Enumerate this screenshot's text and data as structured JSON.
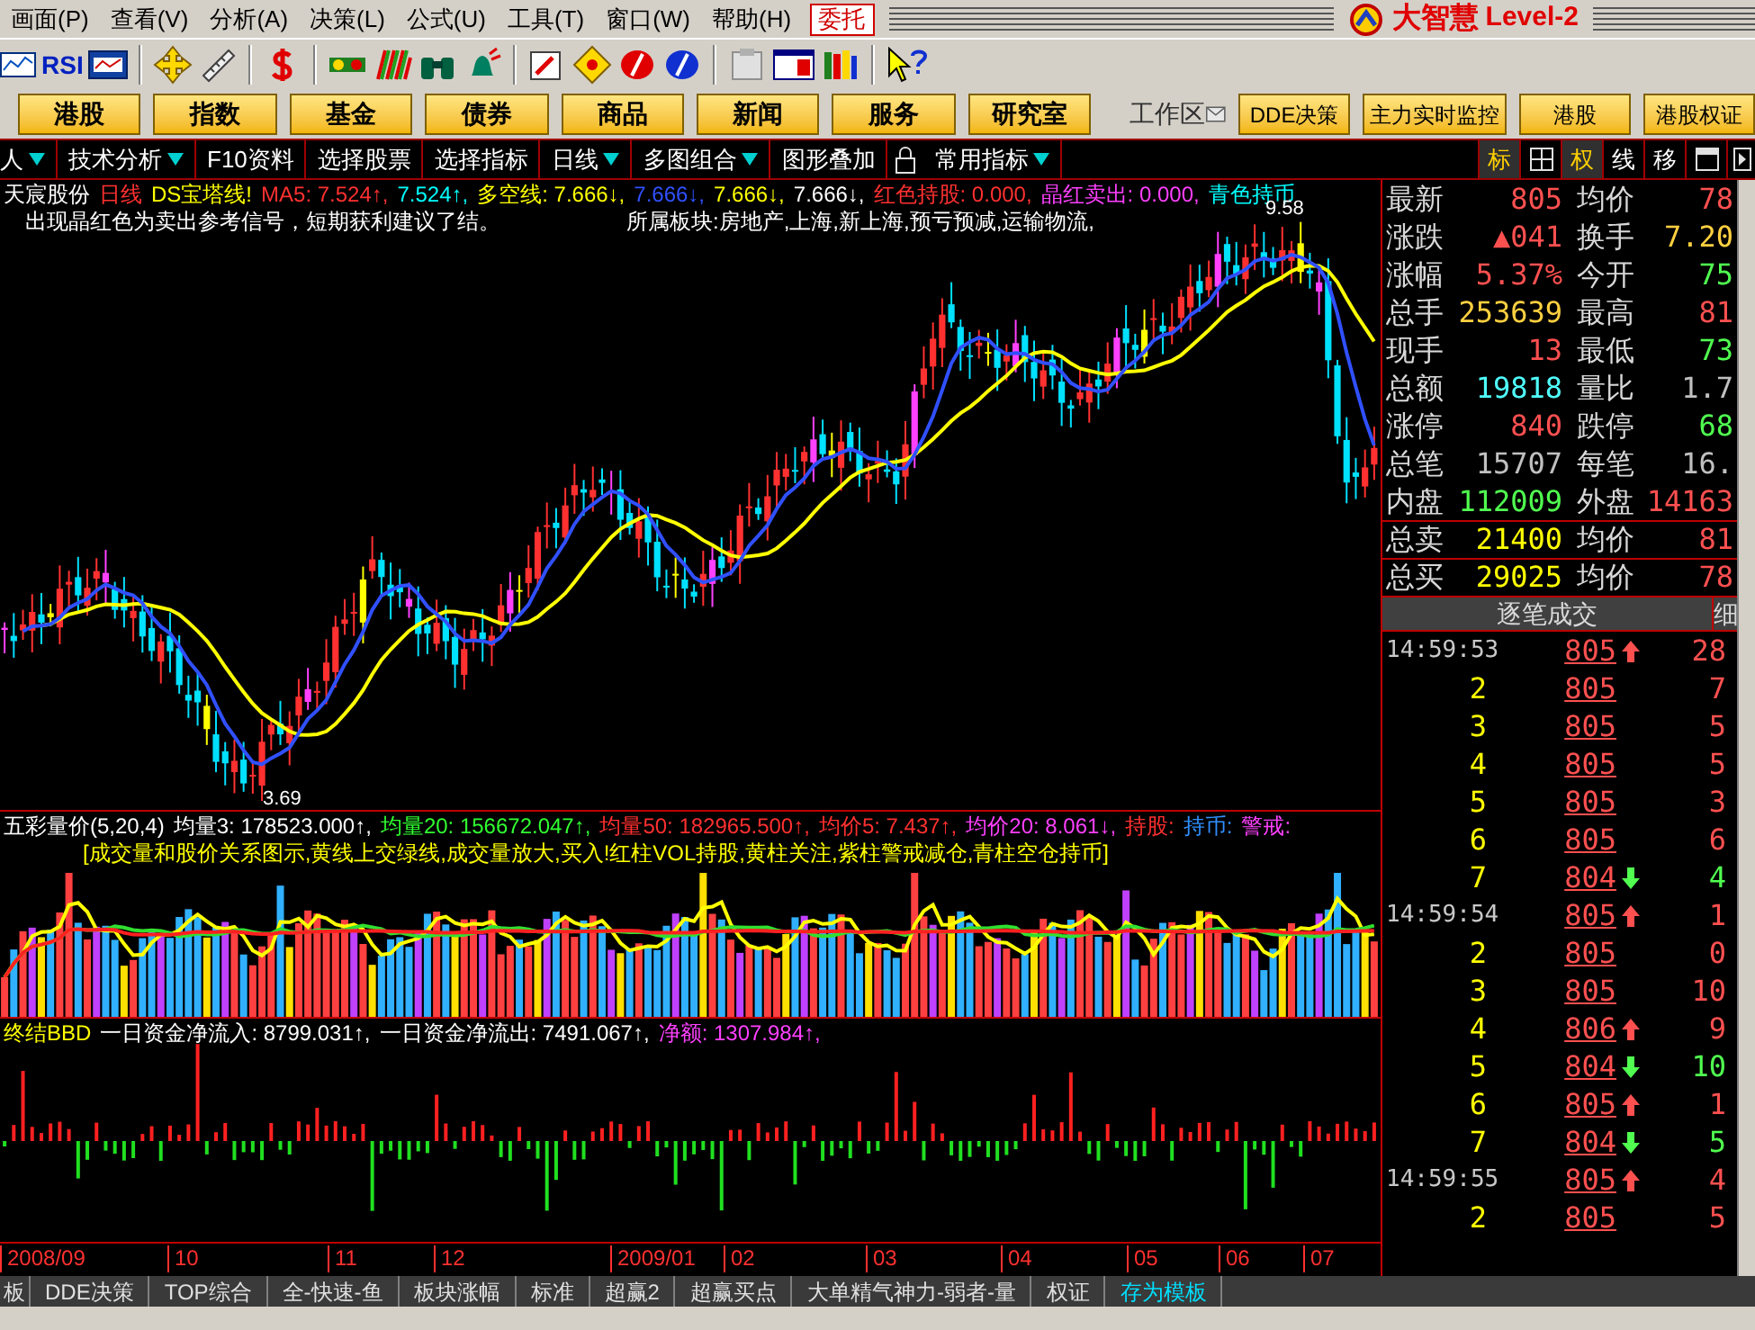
{
  "menu": [
    {
      "label": "画面(P)"
    },
    {
      "label": "查看(V)"
    },
    {
      "label": "分析(A)"
    },
    {
      "label": "决策(L)"
    },
    {
      "label": "公式(U)"
    },
    {
      "label": "工具(T)"
    },
    {
      "label": "窗口(W)"
    },
    {
      "label": "帮助(H)"
    }
  ],
  "entrust_button": "委托",
  "brand": {
    "name": "大智慧",
    "edition": "Level-2"
  },
  "toolbar": {
    "rsi_label": "RSI"
  },
  "nav_buttons": [
    "港股",
    "指数",
    "基金",
    "债券",
    "商品",
    "新闻",
    "服务",
    "研究室"
  ],
  "workspace_label": "工作区",
  "right_buttons": [
    "DDE决策",
    "主力实时监控",
    "港股",
    "港股权证"
  ],
  "tabs": [
    {
      "label": "人",
      "dropdown": true
    },
    {
      "label": "技术分析",
      "dropdown": true
    },
    {
      "label": "F10资料",
      "dropdown": false
    },
    {
      "label": "选择股票",
      "dropdown": false
    },
    {
      "label": "选择指标",
      "dropdown": false
    },
    {
      "label": "日线",
      "dropdown": true
    },
    {
      "label": "多图组合",
      "dropdown": true
    },
    {
      "label": "图形叠加",
      "dropdown": false
    },
    {
      "label": "常用指标",
      "dropdown": true
    }
  ],
  "view_toggles": [
    {
      "kind": "text",
      "label": "标",
      "selected": true
    },
    {
      "kind": "grid"
    },
    {
      "kind": "text",
      "label": "权",
      "selected": true
    },
    {
      "kind": "text",
      "label": "线",
      "selected": false
    },
    {
      "kind": "text",
      "label": "移",
      "selected": false
    },
    {
      "kind": "window"
    },
    {
      "kind": "play"
    }
  ],
  "price_chart": {
    "legend": [
      {
        "text": "天宸股份",
        "color": "#ffffff"
      },
      {
        "text": "日线",
        "color": "#ff3030"
      },
      {
        "text": "DS宝塔线!",
        "color": "#ffff00"
      },
      {
        "text": "MA5: 7.524↑,",
        "color": "#ff3030"
      },
      {
        "text": "7.524↑,",
        "color": "#00ffff"
      },
      {
        "text": "多空线: 7.666↓,",
        "color": "#ffff00"
      },
      {
        "text": "7.666↓,",
        "color": "#3050ff"
      },
      {
        "text": "7.666↓,",
        "color": "#ffff00"
      },
      {
        "text": "7.666↓,",
        "color": "#ffffff"
      },
      {
        "text": "红色持股: 0.000,",
        "color": "#ff3030"
      },
      {
        "text": "晶红卖出: 0.000,",
        "color": "#ff40ff"
      },
      {
        "text": "青色持币",
        "color": "#00ffff"
      }
    ],
    "notes": [
      "出现晶红色为卖出参考信号，短期获利建议了结。",
      "所属板块:房地产,上海,新上海,预亏预减,运输物流,"
    ],
    "high_label": "9.58",
    "low_label": "3.69"
  },
  "volume_chart": {
    "legend": [
      {
        "text": "五彩量价(5,20,4)",
        "color": "#ffffff"
      },
      {
        "text": "均量3: 178523.000↑,",
        "color": "#ffffff"
      },
      {
        "text": "均量20: 156672.047↑,",
        "color": "#30ff30"
      },
      {
        "text": "均量50: 182965.500↑,",
        "color": "#ff3030"
      },
      {
        "text": "均价5: 7.437↑,",
        "color": "#ff3030"
      },
      {
        "text": "均价20: 8.061↓,",
        "color": "#ff40ff"
      },
      {
        "text": "持股:",
        "color": "#ff3030"
      },
      {
        "text": "持币:",
        "color": "#3090ff"
      },
      {
        "text": "警戒:",
        "color": "#ff40ff"
      }
    ],
    "note": "[成交量和股价关系图示,黄线上交绿线,成交量放大,买入!红柱VOL持股,黄柱关注,紫柱警戒减仓,青柱空仓持币]"
  },
  "bbd_chart": {
    "legend": [
      {
        "text": "终结BBD",
        "color": "#ffff00"
      },
      {
        "text": "一日资金净流入: 8799.031↑,",
        "color": "#ffffff"
      },
      {
        "text": "一日资金净流出: 7491.067↑,",
        "color": "#ffffff"
      },
      {
        "text": "净额: 1307.984↑,",
        "color": "#ff40ff"
      }
    ]
  },
  "time_axis": [
    "2008/09",
    "10",
    "11",
    "12",
    "2009/01",
    "02",
    "03",
    "04",
    "05",
    "06",
    "07"
  ],
  "quote": [
    {
      "left": {
        "label": "最新",
        "value": "805",
        "color": "#ff5050"
      },
      "right": {
        "label": "均价",
        "value": "78",
        "color": "#ff5050"
      }
    },
    {
      "left": {
        "label": "涨跌",
        "value": "▲041",
        "color": "#ff5050"
      },
      "right": {
        "label": "换手",
        "value": "7.20",
        "color": "#ffd040"
      }
    },
    {
      "left": {
        "label": "涨幅",
        "value": "5.37%",
        "color": "#ff5050"
      },
      "right": {
        "label": "今开",
        "value": "75",
        "color": "#50ff50"
      }
    },
    {
      "left": {
        "label": "总手",
        "value": "253639",
        "color": "#ffd040"
      },
      "right": {
        "label": "最高",
        "value": "81",
        "color": "#ff5050"
      }
    },
    {
      "left": {
        "label": "现手",
        "value": "13",
        "color": "#ff5050"
      },
      "right": {
        "label": "最低",
        "value": "73",
        "color": "#50ff50"
      }
    },
    {
      "left": {
        "label": "总额",
        "value": "19818",
        "color": "#50ffff"
      },
      "right": {
        "label": "量比",
        "value": "1.7",
        "color": "#c0c0c0"
      }
    },
    {
      "left": {
        "label": "涨停",
        "value": "840",
        "color": "#ff5050"
      },
      "right": {
        "label": "跌停",
        "value": "68",
        "color": "#50ff50"
      }
    },
    {
      "left": {
        "label": "总笔",
        "value": "15707",
        "color": "#c0c0c0"
      },
      "right": {
        "label": "每笔",
        "value": "16.",
        "color": "#c0c0c0"
      }
    },
    {
      "left": {
        "label": "内盘",
        "value": "112009",
        "color": "#50ff50"
      },
      "right": {
        "label": "外盘",
        "value": "14163",
        "color": "#ff5050"
      }
    }
  ],
  "order_totals": [
    {
      "label": "总卖",
      "value": "21400",
      "label2": "均价",
      "value2": "81"
    },
    {
      "label": "总买",
      "value": "29025",
      "label2": "均价",
      "value2": "78"
    }
  ],
  "trades_header": "逐笔成交",
  "trades_side_tab": "细",
  "trades": [
    {
      "kind": "time",
      "time": "14:59:53",
      "price": "805",
      "rising": true,
      "falling": false,
      "volume": "28",
      "color": "#ff5050"
    },
    {
      "kind": "seq",
      "time": "2",
      "price": "805",
      "rising": false,
      "falling": false,
      "volume": "7",
      "color": "#ff5050"
    },
    {
      "kind": "seq",
      "time": "3",
      "price": "805",
      "rising": false,
      "falling": false,
      "volume": "5",
      "color": "#ff5050"
    },
    {
      "kind": "seq",
      "time": "4",
      "price": "805",
      "rising": false,
      "falling": false,
      "volume": "5",
      "color": "#ff5050"
    },
    {
      "kind": "seq",
      "time": "5",
      "price": "805",
      "rising": false,
      "falling": false,
      "volume": "3",
      "color": "#ff5050"
    },
    {
      "kind": "seq",
      "time": "6",
      "price": "805",
      "rising": false,
      "falling": false,
      "volume": "6",
      "color": "#ff5050"
    },
    {
      "kind": "seq",
      "time": "7",
      "price": "804",
      "rising": false,
      "falling": true,
      "volume": "4",
      "color": "#50ff50"
    },
    {
      "kind": "time",
      "time": "14:59:54",
      "price": "805",
      "rising": true,
      "falling": false,
      "volume": "1",
      "color": "#ff5050"
    },
    {
      "kind": "seq",
      "time": "2",
      "price": "805",
      "rising": false,
      "falling": false,
      "volume": "0",
      "color": "#ff5050"
    },
    {
      "kind": "seq",
      "time": "3",
      "price": "805",
      "rising": false,
      "falling": false,
      "volume": "10",
      "color": "#ff5050"
    },
    {
      "kind": "seq",
      "time": "4",
      "price": "806",
      "rising": true,
      "falling": false,
      "volume": "9",
      "color": "#ff5050"
    },
    {
      "kind": "seq",
      "time": "5",
      "price": "804",
      "rising": false,
      "falling": true,
      "volume": "10",
      "color": "#50ff50"
    },
    {
      "kind": "seq",
      "time": "6",
      "price": "805",
      "rising": true,
      "falling": false,
      "volume": "1",
      "color": "#ff5050"
    },
    {
      "kind": "seq",
      "time": "7",
      "price": "804",
      "rising": false,
      "falling": true,
      "volume": "5",
      "color": "#50ff50"
    },
    {
      "kind": "time",
      "time": "14:59:55",
      "price": "805",
      "rising": true,
      "falling": false,
      "volume": "4",
      "color": "#ff5050"
    },
    {
      "kind": "seq",
      "time": "2",
      "price": "805",
      "rising": false,
      "falling": false,
      "volume": "5",
      "color": "#ff5050"
    }
  ],
  "status_tabs": [
    {
      "label": "板",
      "kind": "tab"
    },
    {
      "label": "DDE决策",
      "kind": "tab"
    },
    {
      "label": "TOP综合",
      "kind": "tab"
    },
    {
      "label": "全-快速-鱼",
      "kind": "tab"
    },
    {
      "label": "板块涨幅",
      "kind": "tab"
    },
    {
      "label": "标准",
      "kind": "tab"
    },
    {
      "label": "超赢2",
      "kind": "tab"
    },
    {
      "label": "超赢买点",
      "kind": "tab"
    },
    {
      "label": "大单精气神力-弱者-量",
      "kind": "tab"
    },
    {
      "label": "权证",
      "kind": "tab"
    },
    {
      "label": "存为模板",
      "kind": "action"
    }
  ]
}
